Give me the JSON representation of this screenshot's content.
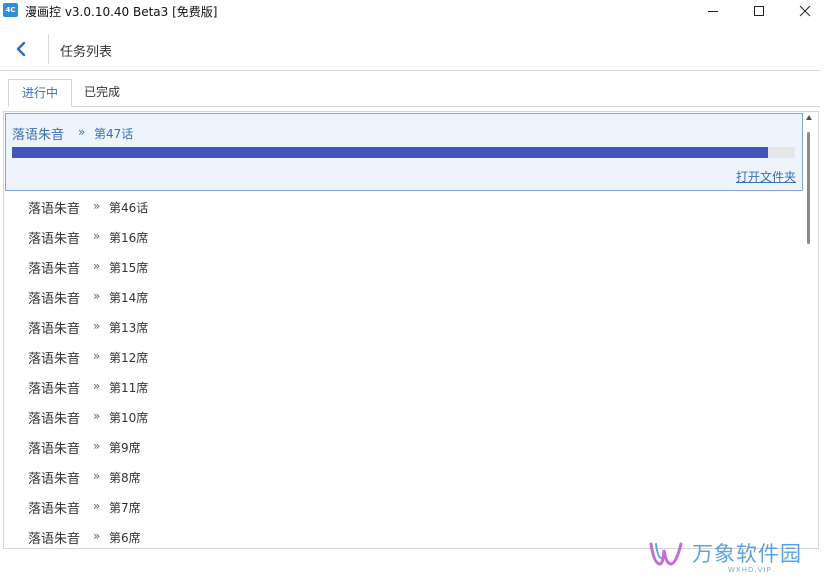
{
  "window": {
    "title": "漫画控 v3.0.10.40 Beta3 [免费版]",
    "icon_label": "4C"
  },
  "header": {
    "title": "任务列表"
  },
  "tabs": [
    {
      "label": "进行中",
      "active": true
    },
    {
      "label": "已完成",
      "active": false
    }
  ],
  "active_task": {
    "name": "落语朱音",
    "separator": "»",
    "episode": "第47话",
    "progress": 0.965,
    "open_folder_label": "打开文件夹"
  },
  "tasks": [
    {
      "name": "落语朱音",
      "separator": "»",
      "episode": "第46话"
    },
    {
      "name": "落语朱音",
      "separator": "»",
      "episode": "第16席"
    },
    {
      "name": "落语朱音",
      "separator": "»",
      "episode": "第15席"
    },
    {
      "name": "落语朱音",
      "separator": "»",
      "episode": "第14席"
    },
    {
      "name": "落语朱音",
      "separator": "»",
      "episode": "第13席"
    },
    {
      "name": "落语朱音",
      "separator": "»",
      "episode": "第12席"
    },
    {
      "name": "落语朱音",
      "separator": "»",
      "episode": "第11席"
    },
    {
      "name": "落语朱音",
      "separator": "»",
      "episode": "第10席"
    },
    {
      "name": "落语朱音",
      "separator": "»",
      "episode": "第9席"
    },
    {
      "name": "落语朱音",
      "separator": "»",
      "episode": "第8席"
    },
    {
      "name": "落语朱音",
      "separator": "»",
      "episode": "第7席"
    },
    {
      "name": "落语朱音",
      "separator": "»",
      "episode": "第6席"
    }
  ],
  "watermark": {
    "text": "万象软件园",
    "sub": "WXHD.VIP"
  },
  "colors": {
    "accent": "#3b6fb6",
    "progress": "#4355b8",
    "active_bg": "#eef4fb"
  }
}
